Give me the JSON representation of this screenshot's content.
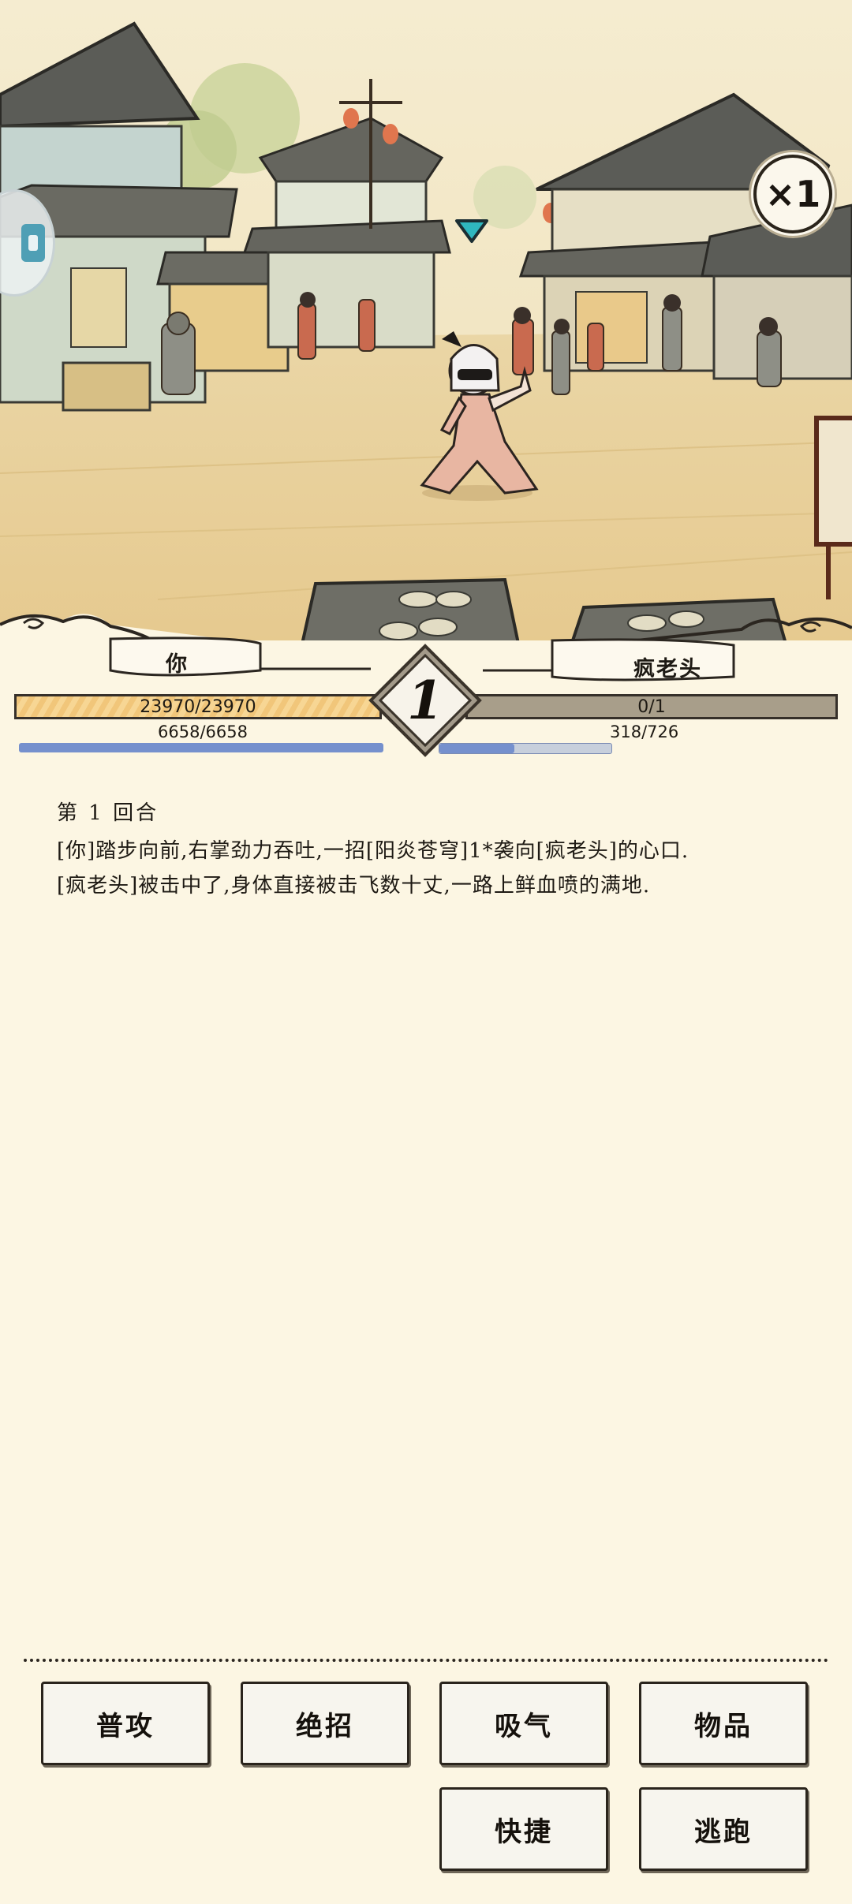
{
  "battle": {
    "speed_label": "×1",
    "round_number": "1"
  },
  "player": {
    "name": "你",
    "hp_text": "23970/23970",
    "hp_fraction": 1.0,
    "mp_text": "6658/6658",
    "mp_fraction": 1.0
  },
  "enemy": {
    "name": "疯老头",
    "hp_text": "0/1",
    "hp_fraction": 0.0,
    "mp_text": "318/726",
    "mp_fraction": 0.438
  },
  "log": {
    "title": "第 1 回合",
    "lines": [
      "[你]踏步向前,右掌劲力吞吐,一招[阳炎苍穹]1*袭向[疯老头]的心口.",
      "[疯老头]被击中了,身体直接被击飞数十丈,一路上鲜血喷的满地."
    ]
  },
  "actions": {
    "attack": "普攻",
    "ultimate": "绝招",
    "breathe": "吸气",
    "items": "物品",
    "quick": "快捷",
    "flee": "逃跑"
  },
  "colors": {
    "parchment": "#fcf6e3",
    "hp_player": "#f1c67a",
    "hp_enemy": "#9a917d",
    "mp": "#7590cd",
    "target_marker": "#2fb7bf"
  },
  "icons": {
    "target_marker": "down-triangle-icon",
    "auto_toggle": "auto-battle-icon"
  }
}
